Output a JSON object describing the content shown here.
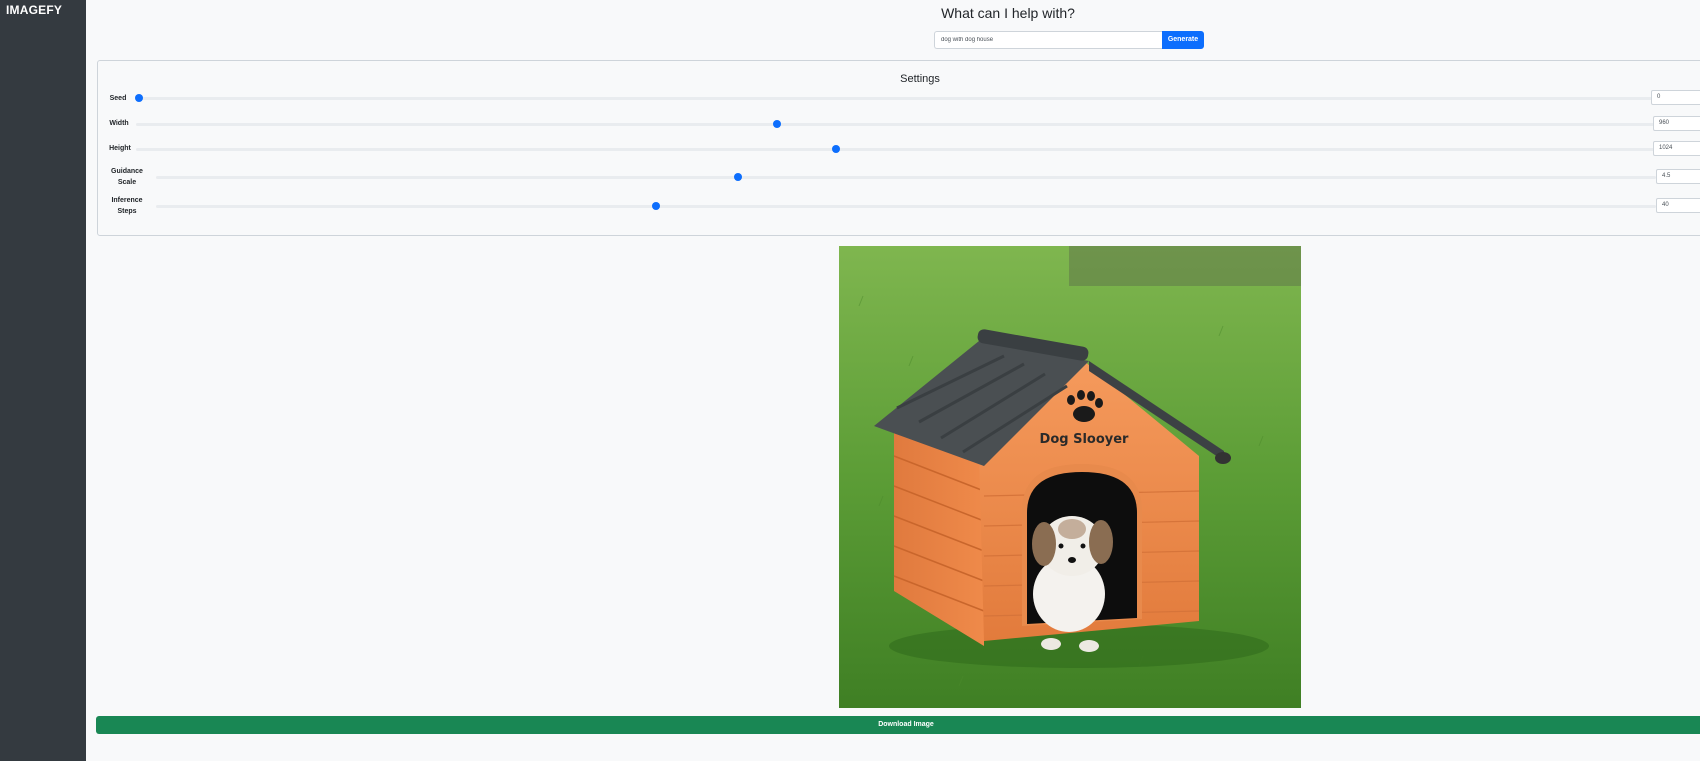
{
  "app": {
    "brand": "IMAGEFY"
  },
  "header": {
    "title": "What can I help with?"
  },
  "prompt": {
    "value": "dog with dog house",
    "button_label": "Generate"
  },
  "settings": {
    "title": "Settings",
    "items": [
      {
        "label": "Seed",
        "value": "0",
        "fraction": 0.0
      },
      {
        "label": "Width",
        "value": "960",
        "fraction": 0.43
      },
      {
        "label": "Height",
        "value": "1024",
        "fraction": 0.46
      },
      {
        "label": "Guidance Scale",
        "value": "4.5",
        "fraction": 0.39
      },
      {
        "label": "Inference Steps",
        "value": "40",
        "fraction": 0.33
      }
    ]
  },
  "result": {
    "sign_text": "Dog Slooyer",
    "download_label": "Download Image"
  },
  "colors": {
    "sidebar": "#343a40",
    "accent": "#0d6efd",
    "success": "#198754"
  }
}
